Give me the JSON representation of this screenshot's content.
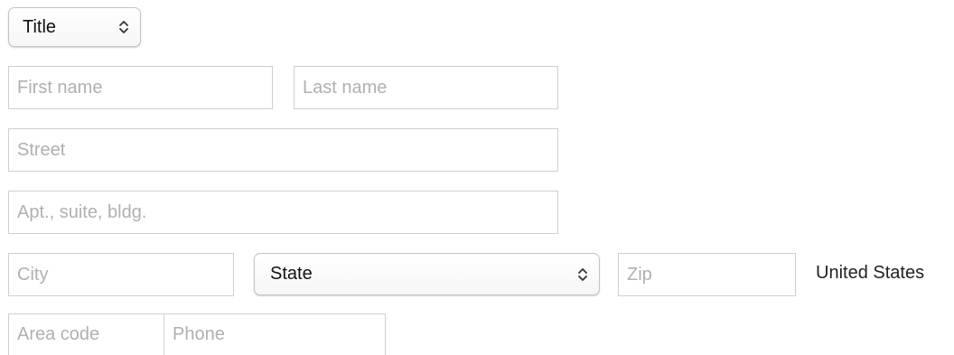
{
  "title_select": {
    "value": "Title"
  },
  "name": {
    "first_placeholder": "First name",
    "last_placeholder": "Last name"
  },
  "address": {
    "street_placeholder": "Street",
    "apt_placeholder": "Apt., suite, bldg.",
    "city_placeholder": "City",
    "state_value": "State",
    "zip_placeholder": "Zip",
    "country": "United States"
  },
  "phone": {
    "area_code_placeholder": "Area code",
    "phone_placeholder": "Phone"
  },
  "icons": {
    "select_indicator": "chevron-up-down-icon"
  }
}
